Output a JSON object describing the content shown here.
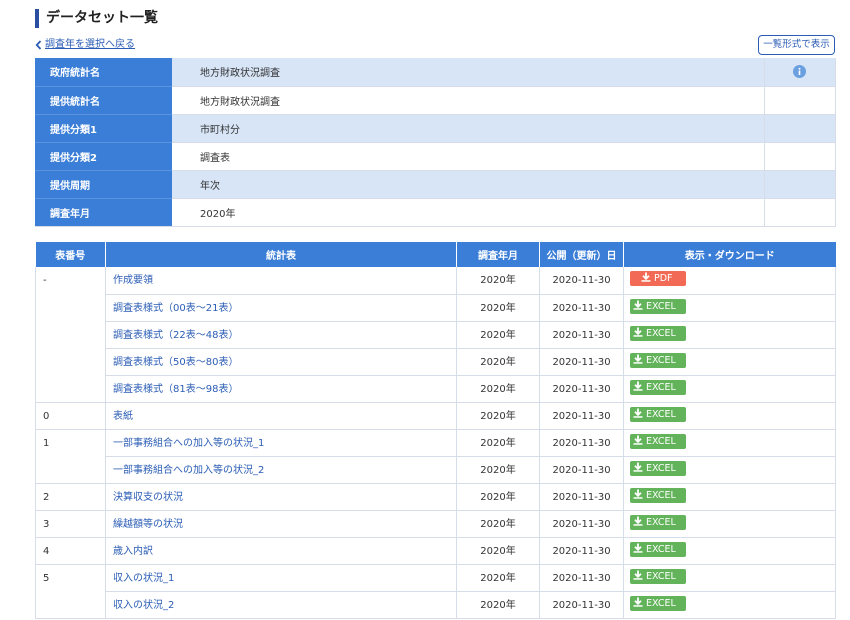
{
  "page_title": "データセット一覧",
  "back_link": "調査年を選択へ戻る",
  "list_view_button": "一覧形式で表示",
  "info": [
    {
      "label": "政府統計名",
      "value": "地方財政状況調査"
    },
    {
      "label": "提供統計名",
      "value": "地方財政状況調査"
    },
    {
      "label": "提供分類1",
      "value": "市町村分"
    },
    {
      "label": "提供分類2",
      "value": "調査表"
    },
    {
      "label": "提供周期",
      "value": "年次"
    },
    {
      "label": "調査年月",
      "value": "2020年"
    }
  ],
  "table": {
    "headers": [
      "表番号",
      "統計表",
      "調査年月",
      "公開（更新）日",
      "表示・ダウンロード"
    ],
    "rows": [
      {
        "num": "-",
        "name": "作成要領",
        "year": "2020年",
        "date": "2020-11-30",
        "type": "PDF"
      },
      {
        "num": "",
        "name": "調査表様式（00表～21表）",
        "year": "2020年",
        "date": "2020-11-30",
        "type": "EXCEL"
      },
      {
        "num": "",
        "name": "調査表様式（22表～48表）",
        "year": "2020年",
        "date": "2020-11-30",
        "type": "EXCEL"
      },
      {
        "num": "",
        "name": "調査表様式（50表～80表）",
        "year": "2020年",
        "date": "2020-11-30",
        "type": "EXCEL"
      },
      {
        "num": "",
        "name": "調査表様式（81表～98表）",
        "year": "2020年",
        "date": "2020-11-30",
        "type": "EXCEL"
      },
      {
        "num": "0",
        "name": "表紙",
        "year": "2020年",
        "date": "2020-11-30",
        "type": "EXCEL"
      },
      {
        "num": "1",
        "name": "一部事務組合への加入等の状況_1",
        "year": "2020年",
        "date": "2020-11-30",
        "type": "EXCEL"
      },
      {
        "num": "",
        "name": "一部事務組合への加入等の状況_2",
        "year": "2020年",
        "date": "2020-11-30",
        "type": "EXCEL"
      },
      {
        "num": "2",
        "name": "決算収支の状況",
        "year": "2020年",
        "date": "2020-11-30",
        "type": "EXCEL"
      },
      {
        "num": "3",
        "name": "繰越額等の状況",
        "year": "2020年",
        "date": "2020-11-30",
        "type": "EXCEL"
      },
      {
        "num": "4",
        "name": "歳入内訳",
        "year": "2020年",
        "date": "2020-11-30",
        "type": "EXCEL"
      },
      {
        "num": "5",
        "name": "収入の状況_1",
        "year": "2020年",
        "date": "2020-11-30",
        "type": "EXCEL"
      },
      {
        "num": "",
        "name": "収入の状況_2",
        "year": "2020年",
        "date": "2020-11-30",
        "type": "EXCEL"
      }
    ]
  },
  "colors": {
    "header_blue": "#3b7ed7",
    "alt_row": "#d7e5f7",
    "pdf": "#f26a55",
    "excel": "#62b35a",
    "link": "#2b5db5"
  },
  "icons": {
    "back": "chevron-left-icon",
    "info": "info-circle-icon",
    "download": "download-icon"
  }
}
